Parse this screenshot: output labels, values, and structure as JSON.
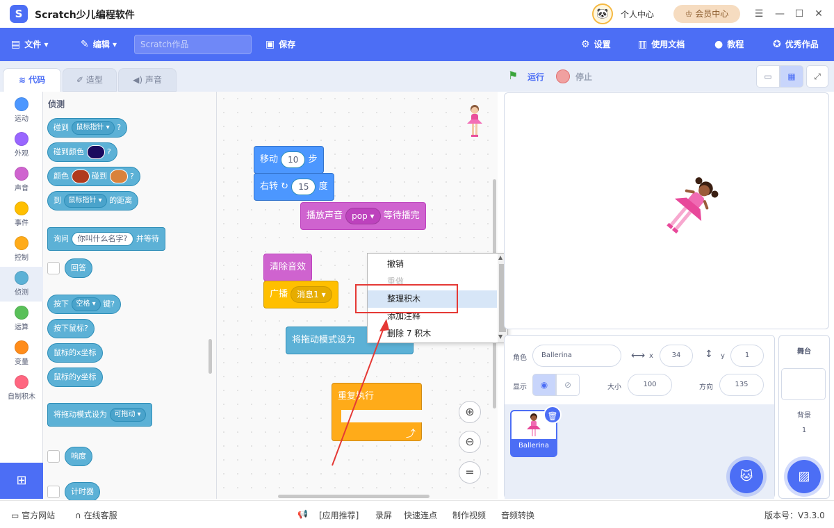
{
  "app": {
    "title": "Scratch少儿编程软件",
    "user_center": "个人中心",
    "vip": "会员中心"
  },
  "menu": {
    "file": "文件",
    "edit": "编辑",
    "title_placeholder": "Scratch作品",
    "save": "保存",
    "settings": "设置",
    "docs": "使用文档",
    "tutorial": "教程",
    "showcase": "优秀作品"
  },
  "tabs": [
    "代码",
    "造型",
    "声音"
  ],
  "categories": [
    {
      "label": "运动",
      "color": "#4c97ff"
    },
    {
      "label": "外观",
      "color": "#9966ff"
    },
    {
      "label": "声音",
      "color": "#cf63cf"
    },
    {
      "label": "事件",
      "color": "#ffbf00"
    },
    {
      "label": "控制",
      "color": "#ffab19"
    },
    {
      "label": "侦测",
      "color": "#5cb1d6"
    },
    {
      "label": "运算",
      "color": "#59c059"
    },
    {
      "label": "变量",
      "color": "#ff8c1a"
    },
    {
      "label": "自制积木",
      "color": "#ff6680"
    }
  ],
  "palette": {
    "section": "侦测",
    "touching": "碰到",
    "mouse_pointer": "鼠标指针",
    "q": "?",
    "touching_color": "碰到颜色",
    "color": "颜色",
    "touches": "碰到",
    "to": "到",
    "distance": "的距离",
    "ask": "询问",
    "ask_default": "你叫什么名字?",
    "and_wait": "并等待",
    "answer": "回答",
    "press": "按下",
    "space": "空格",
    "key": "键?",
    "mouse_down": "按下鼠标?",
    "mouse_x": "鼠标的x坐标",
    "mouse_y": "鼠标的y坐标",
    "drag_mode": "将拖动模式设为",
    "draggable": "可拖动",
    "loudness": "响度",
    "timer": "计时器"
  },
  "script": {
    "move": "移动",
    "move_steps": "10",
    "steps": "步",
    "turn": "右转",
    "turn_deg": "15",
    "degrees": "度",
    "play_sound": "播放声音",
    "sound_name": "pop",
    "until_done": "等待播完",
    "clear_effects": "清除音效",
    "broadcast": "广播",
    "message": "消息1",
    "drag_mode": "将拖动模式设为",
    "forever": "重复执行"
  },
  "context_menu": {
    "undo": "撤销",
    "redo": "重做",
    "cleanup": "整理积木",
    "add_comment": "添加注释",
    "delete": "删除 7 积木"
  },
  "stage_controls": {
    "run": "运行",
    "stop": "停止"
  },
  "sprite_info": {
    "sprite_label": "角色",
    "name": "Ballerina",
    "x_label": "x",
    "x": "34",
    "y_label": "y",
    "y": "1",
    "show_label": "显示",
    "size_label": "大小",
    "size": "100",
    "direction_label": "方向",
    "direction": "135"
  },
  "sprites": [
    {
      "name": "Ballerina"
    }
  ],
  "stage_panel": {
    "title": "舞台",
    "backdrops_label": "背景",
    "backdrops_count": "1"
  },
  "status": {
    "website": "官方网站",
    "support": "在线客服",
    "recommend": "[应用推荐]",
    "record": "录屏",
    "quick_connect": "快速连点",
    "make_video": "制作视频",
    "audio_convert": "音频转换",
    "version": "版本号：V3.3.0"
  }
}
